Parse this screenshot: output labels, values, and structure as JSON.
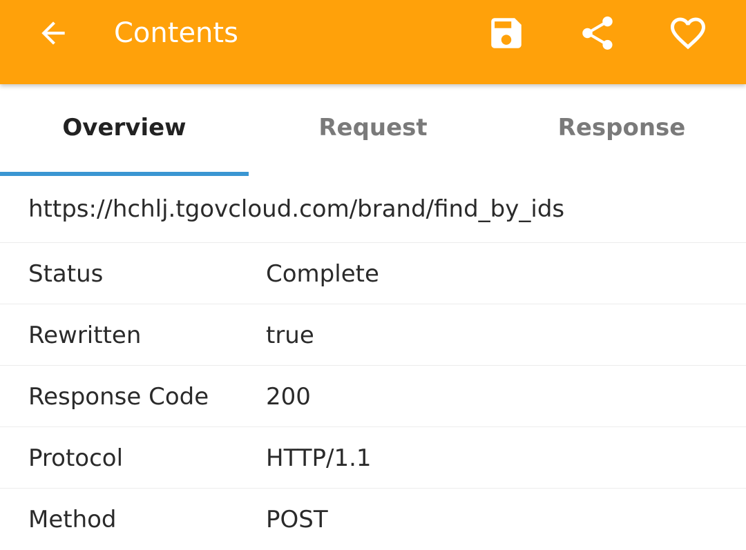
{
  "appbar": {
    "title": "Contents",
    "background": "#FFA10A",
    "icons": {
      "back": "arrow-left-icon",
      "save": "floppy-disk-icon",
      "share": "share-icon",
      "favorite": "heart-outline-icon"
    }
  },
  "tabs": [
    {
      "label": "Overview",
      "active": true
    },
    {
      "label": "Request",
      "active": false
    },
    {
      "label": "Response",
      "active": false
    }
  ],
  "indicator_color": "#3A96D2",
  "overview": {
    "url": "https://hchlj.tgovcloud.com/brand/find_by_ids",
    "rows": [
      {
        "label": "Status",
        "value": "Complete"
      },
      {
        "label": "Rewritten",
        "value": "true"
      },
      {
        "label": "Response Code",
        "value": "200"
      },
      {
        "label": "Protocol",
        "value": "HTTP/1.1"
      },
      {
        "label": "Method",
        "value": "POST"
      }
    ]
  }
}
